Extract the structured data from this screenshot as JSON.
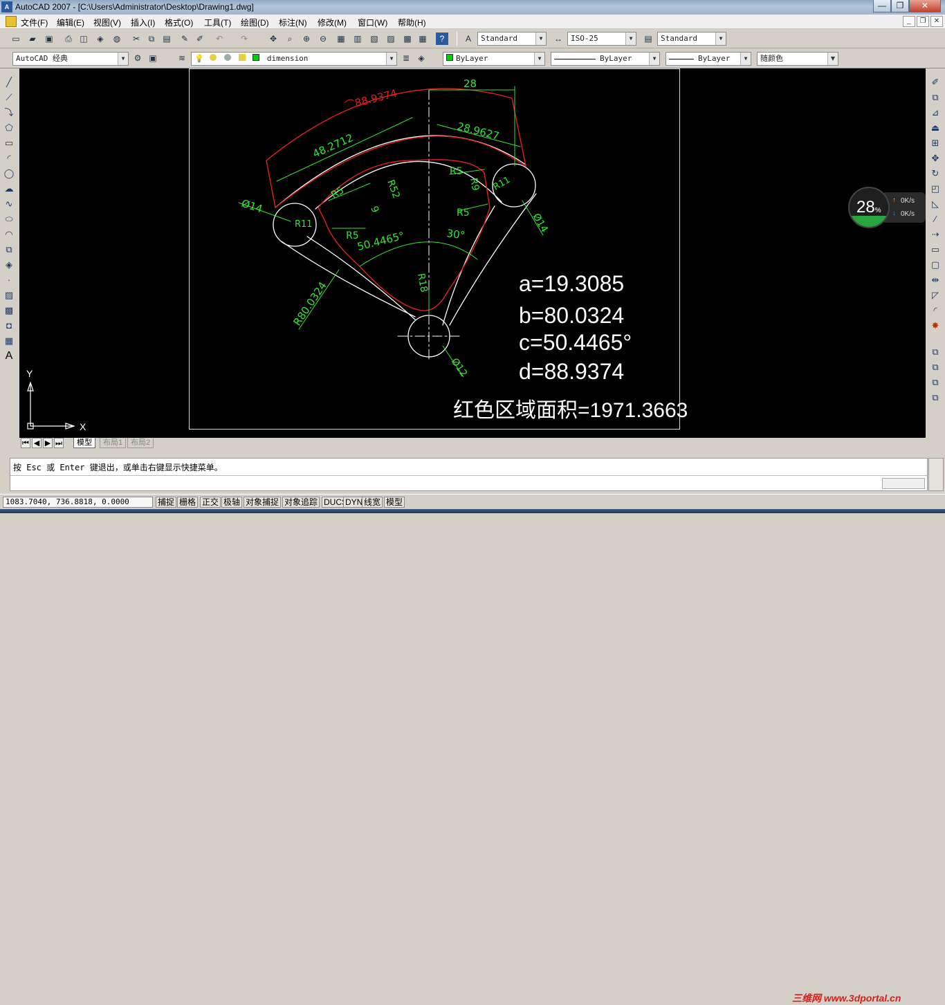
{
  "window": {
    "app_icon": "A",
    "title": "AutoCAD 2007 - [C:\\Users\\Administrator\\Desktop\\Drawing1.dwg]",
    "minimize": "—",
    "maximize": "❐",
    "close": "✕"
  },
  "menu": {
    "items": [
      "文件(F)",
      "编辑(E)",
      "视图(V)",
      "插入(I)",
      "格式(O)",
      "工具(T)",
      "绘图(D)",
      "标注(N)",
      "修改(M)",
      "窗口(W)",
      "帮助(H)"
    ],
    "doc_minimize": "_",
    "doc_restore": "❐",
    "doc_close": "✕"
  },
  "toolbar1": {
    "text_style": "Standard",
    "dim_style": "ISO-25",
    "table_style": "Standard"
  },
  "toolbar2": {
    "workspace": "AutoCAD 经典",
    "layer": "dimension",
    "color": "ByLayer",
    "linetype": "ByLayer",
    "lineweight": "ByLayer",
    "plot_style": "随颜色"
  },
  "drawing": {
    "dims": {
      "top_28": "28",
      "arc_red": "⌒88.9374",
      "len_48": "48.2712",
      "len_28b": "28.9627",
      "r5_a": "R5",
      "r5_b": "R5",
      "r5_c": "R5",
      "r5_d": "R5",
      "r52": "R52",
      "r9_left": "9",
      "r9_right": "R9",
      "r11": "R11",
      "r11b": "R11",
      "d14_left": "Ø14",
      "d14_right": "Ø14",
      "ang_50": "50.4465°",
      "ang_30": "30°",
      "r80": "R80.0324",
      "r18": "R18",
      "d12": "Ø12"
    },
    "results": {
      "a": "a=19.3085",
      "b": "b=80.0324",
      "c": "c=50.4465°",
      "d": "d=88.9374",
      "area": "红色区域面积=1971.3663"
    },
    "ucs": {
      "x": "X",
      "y": "Y"
    }
  },
  "tabs": {
    "model": "模型",
    "layout1": "布局1",
    "layout2": "布局2"
  },
  "command": {
    "line": "按 Esc 或 Enter 键退出，或单击右键显示快捷菜单。"
  },
  "status": {
    "coords": "1083.7040, 736.8818, 0.0000",
    "buttons": [
      "捕捉",
      "栅格",
      "正交",
      "极轴",
      "对象捕捉",
      "对象追踪",
      "DUCS",
      "DYN",
      "线宽",
      "模型"
    ]
  },
  "net_widget": {
    "percent": "28",
    "percent_sign": "%",
    "up": "0K/s",
    "down": "0K/s",
    "ratio": 0.28
  },
  "watermark": "三维网 www.3dportal.cn",
  "colors": {
    "dim_green": "#33e633",
    "red_region": "#e02020",
    "geometry_white": "#ffffff"
  }
}
